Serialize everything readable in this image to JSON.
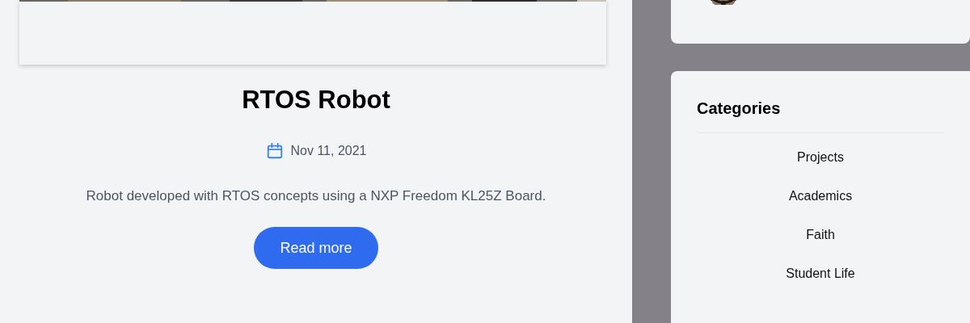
{
  "post": {
    "title": "RTOS Robot",
    "date": "Nov 11, 2021",
    "excerpt": "Robot developed with RTOS concepts using a NXP Freedom KL25Z Board.",
    "button": "Read more"
  },
  "categories": {
    "title": "Categories",
    "items": [
      {
        "label": "Projects"
      },
      {
        "label": "Academics"
      },
      {
        "label": "Faith"
      },
      {
        "label": "Student Life"
      }
    ]
  }
}
